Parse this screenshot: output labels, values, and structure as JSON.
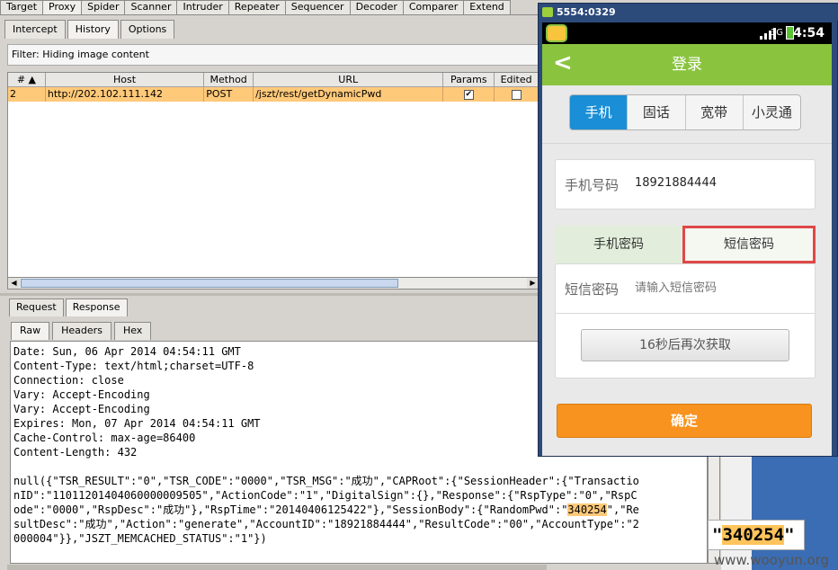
{
  "burp": {
    "main_tabs": [
      "Target",
      "Proxy",
      "Spider",
      "Scanner",
      "Intruder",
      "Repeater",
      "Sequencer",
      "Decoder",
      "Comparer",
      "Extend"
    ],
    "sub_tabs": [
      "Intercept",
      "History",
      "Options"
    ],
    "filter": "Filter: Hiding image content",
    "table": {
      "headers": [
        "# ▲",
        "Host",
        "Method",
        "URL",
        "Params",
        "Edited"
      ],
      "rows": [
        {
          "num": "2",
          "host": "http://202.102.111.142",
          "method": "POST",
          "url": "/jszt/rest/getDynamicPwd",
          "params": "✔",
          "edited": ""
        }
      ]
    },
    "rr_tabs": [
      "Request",
      "Response"
    ],
    "fmt_tabs": [
      "Raw",
      "Headers",
      "Hex"
    ],
    "response_lines": {
      "l1": "Date: Sun, 06 Apr 2014 04:54:11 GMT",
      "l2": "Content-Type: text/html;charset=UTF-8",
      "l3": "Connection: close",
      "l4": "Vary: Accept-Encoding",
      "l5": "Vary: Accept-Encoding",
      "l6": "Expires: Mon, 07 Apr 2014 04:54:11 GMT",
      "l7": "Cache-Control: max-age=86400",
      "l8": "Content-Length: 432",
      "b1": "null({\"TSR_RESULT\":\"0\",\"TSR_CODE\":\"0000\",\"TSR_MSG\":\"成功\",\"CAPRoot\":{\"SessionHeader\":{\"Transactio",
      "b2": "nID\":\"11011201404060000009505\",\"ActionCode\":\"1\",\"DigitalSign\":{},\"Response\":{\"RspType\":\"0\",\"RspC",
      "b3": "ode\":\"0000\",\"RspDesc\":\"成功\"},\"RspTime\":\"20140406125422\"},\"SessionBody\":{\"RandomPwd\":\"",
      "b3_hl": "340254",
      "b3_end": "\",\"Re",
      "b4": "sultDesc\":\"成功\",\"Action\":\"generate\",\"AccountID\":\"18921884444\",\"ResultCode\":\"00\",\"AccountType\":\"2",
      "b5": "000004\"}},\"JSZT_MEMCACHED_STATUS\":\"1\"})"
    }
  },
  "emulator": {
    "title": "5554:0329",
    "clock": "4:54",
    "signal": "3G",
    "appbar_title": "登录",
    "seg": [
      "手机",
      "固话",
      "宽带",
      "小灵通"
    ],
    "phone_label": "手机号码",
    "phone_value": "18921884444",
    "pwd_tabs": [
      "手机密码",
      "短信密码"
    ],
    "sms_label": "短信密码",
    "sms_placeholder": "请输入短信密码",
    "resend": "16秒后再次获取",
    "confirm": "确定"
  },
  "zoom_text_pre": "\"",
  "zoom_text": "340254",
  "zoom_text_post": "\"",
  "watermark": "www.wooyun.org"
}
